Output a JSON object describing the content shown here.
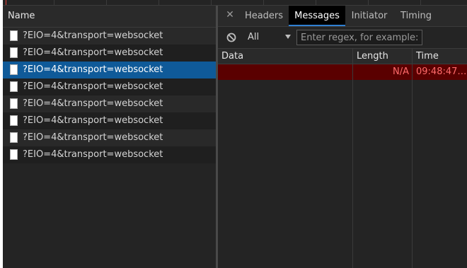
{
  "requests_panel": {
    "header": "Name",
    "items": [
      {
        "name": "?EIO=4&transport=websocket",
        "selected": false
      },
      {
        "name": "?EIO=4&transport=websocket",
        "selected": false
      },
      {
        "name": "?EIO=4&transport=websocket",
        "selected": true
      },
      {
        "name": "?EIO=4&transport=websocket",
        "selected": false
      },
      {
        "name": "?EIO=4&transport=websocket",
        "selected": false
      },
      {
        "name": "?EIO=4&transport=websocket",
        "selected": false
      },
      {
        "name": "?EIO=4&transport=websocket",
        "selected": false
      },
      {
        "name": "?EIO=4&transport=websocket",
        "selected": false
      }
    ]
  },
  "details_panel": {
    "close_icon": "close-icon",
    "tabs": [
      {
        "label": "Headers",
        "active": false
      },
      {
        "label": "Messages",
        "active": true
      },
      {
        "label": "Initiator",
        "active": false
      },
      {
        "label": "Timing",
        "active": false
      }
    ],
    "filter": {
      "clear_icon": "block-icon",
      "type_value": "All",
      "regex_placeholder": "Enter regex, for example: (we"
    },
    "messages_table": {
      "columns": [
        "Data",
        "Length",
        "Time"
      ],
      "rows": [
        {
          "data": "",
          "length": "N/A",
          "time": "09:48:47....",
          "status": "error"
        }
      ]
    }
  },
  "colors": {
    "background": "#242424",
    "selected_row": "#0f5a99",
    "error_row_bg": "#5a0000",
    "error_text": "#ff6b6b",
    "active_tab_bg": "#000000"
  }
}
